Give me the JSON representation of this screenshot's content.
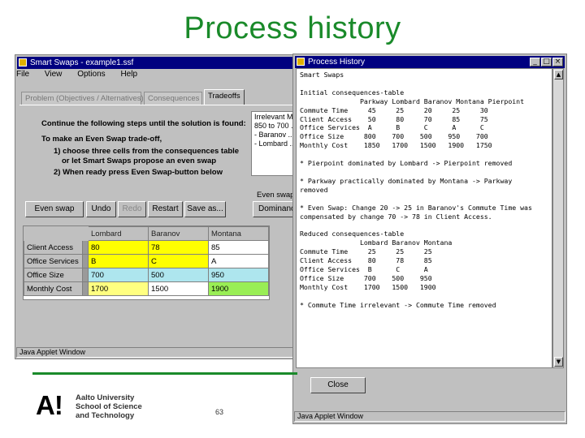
{
  "slide": {
    "title": "Process history",
    "page_number": "63",
    "logo": {
      "mark": "A!",
      "line1": "Aalto University",
      "line2": "School of Science",
      "line3": "and Technology"
    },
    "accent_color": "#1a8a2a"
  },
  "main_window": {
    "title": "Smart Swaps - example1.ssf",
    "menu": [
      "File",
      "View",
      "Options",
      "Help"
    ],
    "tabs": [
      "Problem (Objectives / Alternatives)",
      "Consequences",
      "Tradeoffs"
    ],
    "active_tab": "Tradeoffs",
    "instructions": {
      "line1": "Continue the following steps until the solution is found:",
      "line2": "To make an Even Swap trade-off,",
      "line3": "1) choose three cells from the consequences table",
      "line4": "or let Smart Swaps propose an even swap",
      "line5": "2) When ready press Even Swap-button below"
    },
    "list_items": [
      "Irrelevant Mo",
      "850 to 700 ...",
      "- Baranov ...",
      "- Lombard ..."
    ],
    "buttons": {
      "even_swap": "Even swap",
      "undo": "Undo",
      "redo": "Redo",
      "restart": "Restart",
      "save": "Save as..."
    },
    "even_swap_label": "Even swap",
    "dominance_button": "Dominance",
    "table": {
      "columns": [
        "Lombard",
        "Baranov",
        "Montana"
      ],
      "rows": [
        {
          "label": "Client Access",
          "values": [
            "80",
            "78",
            "85"
          ]
        },
        {
          "label": "Office Services",
          "values": [
            "B",
            "C",
            "A"
          ]
        },
        {
          "label": "Office Size",
          "values": [
            "700",
            "500",
            "950"
          ]
        },
        {
          "label": "Monthly Cost",
          "values": [
            "1700",
            "1500",
            "1900"
          ]
        }
      ]
    },
    "status": "Java Applet Window"
  },
  "history_window": {
    "title": "Process History",
    "lines": [
      "Smart Swaps",
      "",
      "Initial consequences-table",
      "               Parkway Lombard Baranov Montana Pierpoint",
      "Commute Time     45     25     20     25     30",
      "Client Access    50     80     70     85     75",
      "Office Services  A      B      C      A      C",
      "Office Size     800    700    500    950    700",
      "Monthly Cost    1850   1700   1500   1900   1750",
      "",
      "* Pierpoint dominated by Lombard -> Pierpoint removed",
      "",
      "* Parkway practically dominated by Montana -> Parkway",
      "removed",
      "",
      "* Even Swap: Change 20 -> 25 in Baranov's Commute Time was",
      "compensated by change 70 -> 78 in Client Access.",
      "",
      "Reduced consequences-table",
      "               Lombard Baranov Montana",
      "Commute Time     25     25     25",
      "Client Access    80     78     85",
      "Office Services  B      C      A",
      "Office Size     700    500    950",
      "Monthly Cost    1700   1500   1900",
      "",
      "* Commute Time irrelevant -> Commute Time removed"
    ],
    "close_button": "Close",
    "status": "Java Applet Window"
  }
}
